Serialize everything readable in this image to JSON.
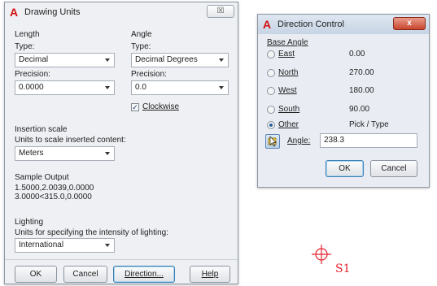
{
  "drawing_units": {
    "title": "Drawing Units",
    "close_glyph": "☒",
    "length": {
      "heading": "Length",
      "type_label": "Type:",
      "type_value": "Decimal",
      "precision_label": "Precision:",
      "precision_value": "0.0000"
    },
    "angle": {
      "heading": "Angle",
      "type_label": "Type:",
      "type_value": "Decimal Degrees",
      "precision_label": "Precision:",
      "precision_value": "0.0",
      "clockwise_label": "Clockwise",
      "clockwise_checked": true
    },
    "insertion": {
      "heading": "Insertion scale",
      "caption": "Units to scale inserted content:",
      "value": "Meters"
    },
    "sample": {
      "heading": "Sample Output",
      "line1": "1.5000,2.0039,0.0000",
      "line2": "3.0000<315.0,0.0000"
    },
    "lighting": {
      "heading": "Lighting",
      "caption": "Units for specifying the intensity of lighting:",
      "value": "International"
    },
    "buttons": {
      "ok": "OK",
      "cancel": "Cancel",
      "direction": "Direction...",
      "help": "Help"
    }
  },
  "direction_control": {
    "title": "Direction Control",
    "close_glyph": "x",
    "group_label": "Base Angle",
    "options": [
      {
        "label": "East",
        "value": "0.00",
        "selected": false
      },
      {
        "label": "North",
        "value": "270.00",
        "selected": false
      },
      {
        "label": "West",
        "value": "180.00",
        "selected": false
      },
      {
        "label": "South",
        "value": "90.00",
        "selected": false
      },
      {
        "label": "Other",
        "value": "Pick / Type",
        "selected": true
      }
    ],
    "angle_label": "Angle:",
    "angle_value": "238.3",
    "buttons": {
      "ok": "OK",
      "cancel": "Cancel"
    }
  },
  "canvas": {
    "marker_label": "S1",
    "marker_color": "#e8222e"
  },
  "colors": {
    "dialog_bg": "#eef0f3",
    "app_icon": "#d40f0f",
    "close_red": "#c9452c"
  }
}
